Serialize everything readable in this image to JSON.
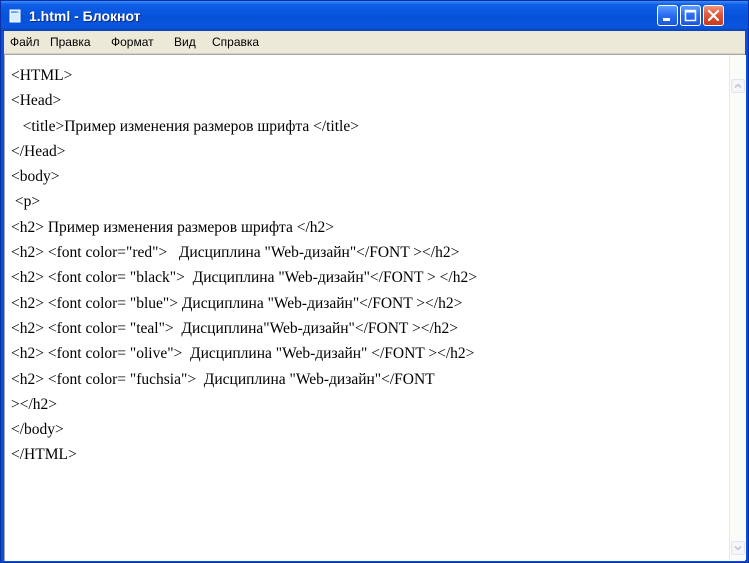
{
  "window": {
    "title": "1.html - Блокнот",
    "icon": "notepad-icon",
    "controls": [
      "minimize-icon",
      "maximize-icon",
      "close-icon"
    ],
    "titlebar_color": "#0752da"
  },
  "menu": {
    "items": [
      "Файл",
      "Правка",
      "Формат",
      "Вид",
      "Справка"
    ]
  },
  "document": {
    "lines": [
      "<HTML>",
      "<Head>",
      "   <title>Пример изменения размеров шрифта </title>",
      "</Head>",
      "<body>",
      " <p>",
      "<h2> Пример изменения размеров шрифта </h2>",
      "<h2> <font color=\"red\">   Дисциплина \"Web-дизайн\"</FONT ></h2>",
      "<h2> <font color= \"black\">  Дисциплина \"Web-дизайн\"</FONT > </h2>",
      "<h2> <font color= \"blue\"> Дисциплина \"Web-дизайн\"</FONT ></h2>",
      "<h2> <font color= \"teal\">  Дисциплина\"Web-дизайн\"</FONT ></h2>",
      "<h2> <font color= \"olive\">  Дисциплина \"Web-дизайн\" </FONT ></h2>",
      "<h2> <font color= \"fuchsia\">  Дисциплина \"Web-дизайн\"</FONT",
      "></h2>",
      "</body>",
      "</HTML>"
    ]
  },
  "scrollbar": {
    "up_icon": "scroll-up-arrow-icon",
    "down_icon": "scroll-down-arrow-icon"
  }
}
